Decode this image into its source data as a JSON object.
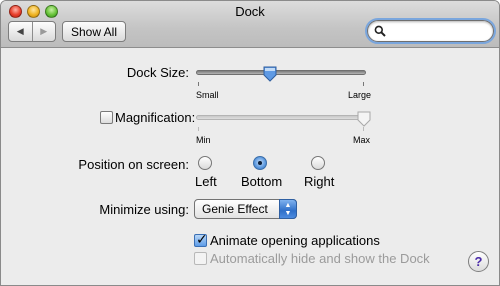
{
  "window": {
    "title": "Dock"
  },
  "toolbar": {
    "back_icon": "back-arrow-icon",
    "forward_icon": "forward-arrow-icon",
    "show_all_label": "Show All",
    "search": {
      "value": "",
      "placeholder": ""
    }
  },
  "dock_size": {
    "label": "Dock Size:",
    "min_label": "Small",
    "max_label": "Large",
    "value_fraction": 0.43
  },
  "magnification": {
    "label": "Magnification:",
    "checked": false,
    "min_label": "Min",
    "max_label": "Max",
    "value_fraction": 1.0
  },
  "position": {
    "label": "Position on screen:",
    "options": [
      "Left",
      "Bottom",
      "Right"
    ],
    "selected": "Bottom"
  },
  "minimize": {
    "label": "Minimize using:",
    "value": "Genie Effect"
  },
  "options": {
    "animate_label": "Animate opening applications",
    "animate_checked": true,
    "autohide_label": "Automatically hide and show the Dock",
    "autohide_checked": false
  },
  "help": {
    "label": "?"
  },
  "colors": {
    "accent": "#3d7ad6",
    "disabled_text": "#9b9b9b"
  }
}
